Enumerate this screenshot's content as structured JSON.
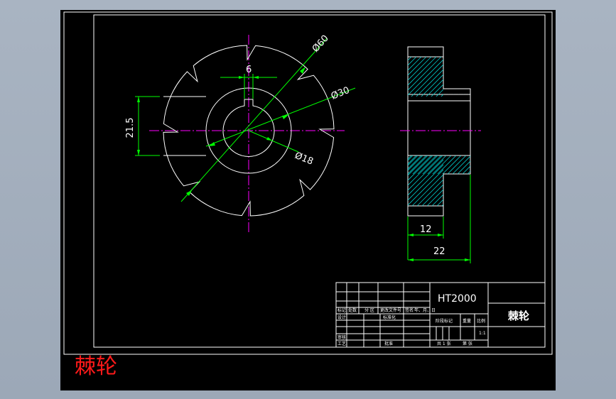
{
  "drawing": {
    "dimensions": {
      "outer_diameter": "Ø60",
      "middle_diameter": "Ø30",
      "bore_diameter": "Ø18",
      "key_width": "6",
      "key_depth": "21.5",
      "hub_width": "12",
      "total_width": "22"
    },
    "title_block": {
      "material": "HT2000",
      "part_name": "棘轮",
      "scale": "1:1",
      "row_labels": [
        "标记",
        "处数",
        "分 区",
        "更改文件号",
        "签名",
        "年、月、日"
      ],
      "designer": "设计",
      "standardize": "标准化",
      "review": "审核",
      "process": "工艺",
      "approve": "批准",
      "stage_mark": "阶段标记",
      "weight": "重量",
      "ratio": "比例",
      "sheets_total": "共 1 张",
      "sheet_no": "第 张"
    }
  },
  "caption": "棘轮",
  "colors": {
    "background": "#a9b4c2",
    "sheet": "#000000",
    "dimension": "#00ff00",
    "centerline": "#ff00ff",
    "outline": "#ffffff",
    "hatch": "#00c8c8",
    "caption": "#ff1a1a"
  }
}
